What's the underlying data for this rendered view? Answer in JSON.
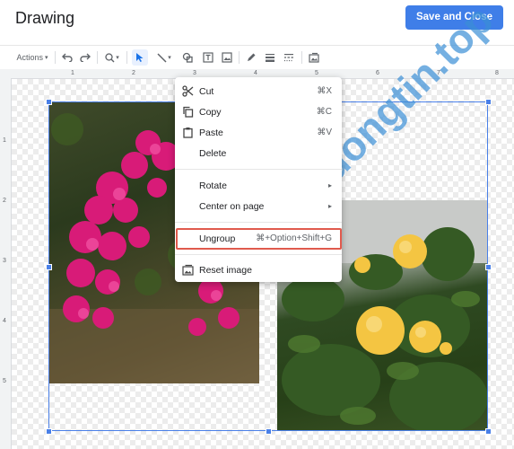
{
  "header": {
    "title": "Drawing",
    "save_label": "Save and Close"
  },
  "toolbar": {
    "actions_label": "Actions"
  },
  "ruler": {
    "top_ticks": [
      "1",
      "2",
      "3",
      "4",
      "5",
      "6",
      "7",
      "8"
    ],
    "left_ticks": [
      "1",
      "2",
      "3",
      "4",
      "5"
    ]
  },
  "menu": {
    "items": [
      {
        "label": "Cut",
        "shortcut": "⌘X",
        "icon": "scissors-icon"
      },
      {
        "label": "Copy",
        "shortcut": "⌘C",
        "icon": "copy-icon"
      },
      {
        "label": "Paste",
        "shortcut": "⌘V",
        "icon": "clipboard-icon"
      },
      {
        "label": "Delete",
        "shortcut": ""
      },
      {
        "label": "Rotate",
        "shortcut": "▸"
      },
      {
        "label": "Center on page",
        "shortcut": "▸"
      },
      {
        "label": "Ungroup",
        "shortcut": "⌘+Option+Shift+G"
      },
      {
        "label": "Reset image",
        "icon": "reset-image-icon"
      }
    ]
  },
  "watermark": {
    "text": "Truongtin.top"
  },
  "colors": {
    "accent": "#3f7ee8",
    "highlight": "#e05a4d",
    "selection": "#4a80e8"
  }
}
